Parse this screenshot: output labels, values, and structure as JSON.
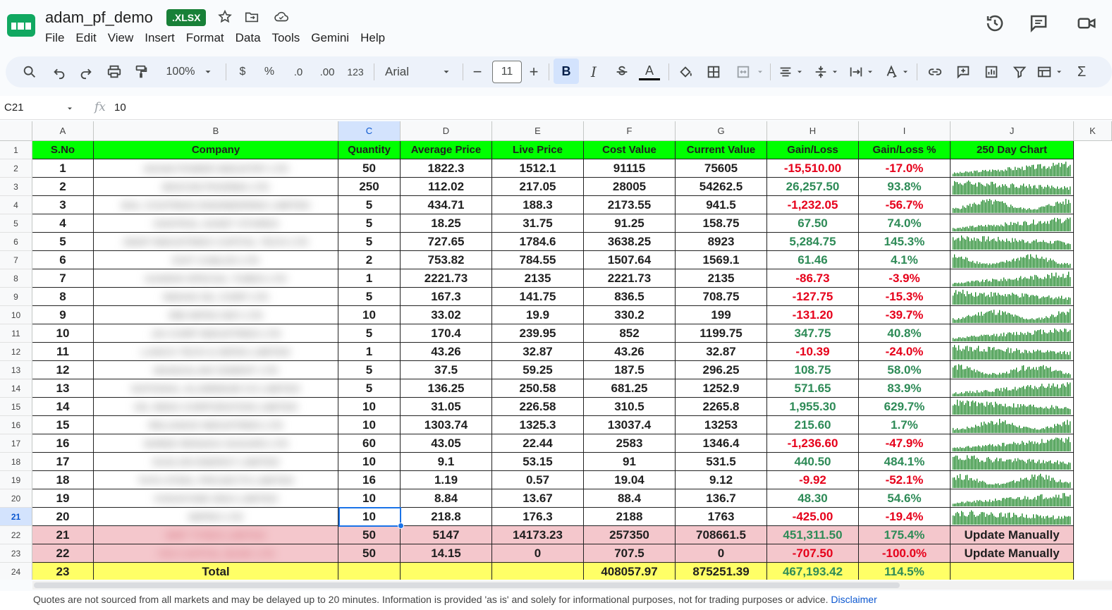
{
  "app": {
    "doc_title": "adam_pf_demo",
    "file_badge": ".XLSX",
    "menu": [
      "File",
      "Edit",
      "View",
      "Insert",
      "Format",
      "Data",
      "Tools",
      "Gemini",
      "Help"
    ]
  },
  "toolbar": {
    "zoom": "100%",
    "currency": "$",
    "percent": "%",
    "dec_decrease": ".0",
    "dec_increase": ".00",
    "number_format": "123",
    "font": "Arial",
    "font_size": "11",
    "minus": "−",
    "plus": "+",
    "bold": "B",
    "italic": "I",
    "text_color": "A",
    "sigma": "Σ"
  },
  "formula_bar": {
    "name_box": "C21",
    "fx": "fx",
    "value": "10"
  },
  "columns": [
    "A",
    "B",
    "C",
    "D",
    "E",
    "F",
    "G",
    "H",
    "I",
    "J",
    "K"
  ],
  "header_row": [
    "S.No",
    "Company",
    "Quantity",
    "Average Price",
    "Live Price",
    "Cost Value",
    "Current Value",
    "Gain/Loss",
    "Gain/Loss %",
    "250 Day Chart"
  ],
  "rows": [
    {
      "sno": "1",
      "company": "ADANI POWER INDUSTRY LTD",
      "qty": "50",
      "avg": "1822.3",
      "live": "1512.1",
      "cost": "91115",
      "cur": "75605",
      "gl": "-15,510.00",
      "glp": "-17.0%",
      "neg": true
    },
    {
      "sno": "2",
      "company": "BIOCON PHARMA LTD",
      "qty": "250",
      "avg": "112.02",
      "live": "217.05",
      "cost": "28005",
      "cur": "54262.5",
      "gl": "26,257.50",
      "glp": "93.8%",
      "neg": false
    },
    {
      "sno": "3",
      "company": "BAL COATINGS ENGINEERING LIMITED",
      "qty": "5",
      "avg": "434.71",
      "live": "188.3",
      "cost": "2173.55",
      "cur": "941.5",
      "gl": "-1,232.05",
      "glp": "-56.7%",
      "neg": true
    },
    {
      "sno": "4",
      "company": "CENTRAL ASSET STORES",
      "qty": "5",
      "avg": "18.25",
      "live": "31.75",
      "cost": "91.25",
      "cur": "158.75",
      "gl": "67.50",
      "glp": "74.0%",
      "neg": false
    },
    {
      "sno": "5",
      "company": "DEEP INDUSTRIES CAPITAL TECH LTD",
      "qty": "5",
      "avg": "727.65",
      "live": "1784.6",
      "cost": "3638.25",
      "cur": "8923",
      "gl": "5,284.75",
      "glp": "145.3%",
      "neg": false
    },
    {
      "sno": "6",
      "company": "EXIT CABLES LTD",
      "qty": "2",
      "avg": "753.82",
      "live": "784.55",
      "cost": "1507.64",
      "cur": "1569.1",
      "gl": "61.46",
      "glp": "4.1%",
      "neg": false
    },
    {
      "sno": "7",
      "company": "GANDHI SPECIAL TUBES LTD",
      "qty": "1",
      "avg": "2221.73",
      "live": "2135",
      "cost": "2221.73",
      "cur": "2135",
      "gl": "-86.73",
      "glp": "-3.9%",
      "neg": true
    },
    {
      "sno": "8",
      "company": "INDIAN OIL CORP LTD",
      "qty": "5",
      "avg": "167.3",
      "live": "141.75",
      "cost": "836.5",
      "cur": "708.75",
      "gl": "-127.75",
      "glp": "-15.3%",
      "neg": true
    },
    {
      "sno": "9",
      "company": "IRB INFRA DEV LTD",
      "qty": "10",
      "avg": "33.02",
      "live": "19.9",
      "cost": "330.2",
      "cur": "199",
      "gl": "-131.20",
      "glp": "-39.7%",
      "neg": true
    },
    {
      "sno": "10",
      "company": "JAI CORP INDUSTRIES LTD",
      "qty": "5",
      "avg": "170.4",
      "live": "239.95",
      "cost": "852",
      "cur": "1199.75",
      "gl": "347.75",
      "glp": "40.8%",
      "neg": false
    },
    {
      "sno": "11",
      "company": "LANCO TECH & INFRA LIMITED",
      "qty": "1",
      "avg": "43.26",
      "live": "32.87",
      "cost": "43.26",
      "cur": "32.87",
      "gl": "-10.39",
      "glp": "-24.0%",
      "neg": true
    },
    {
      "sno": "12",
      "company": "MANGALAM CEMENT LTD",
      "qty": "5",
      "avg": "37.5",
      "live": "59.25",
      "cost": "187.5",
      "cur": "296.25",
      "gl": "108.75",
      "glp": "58.0%",
      "neg": false
    },
    {
      "sno": "13",
      "company": "NATIONAL ALUMINIUM CO LIMITED",
      "qty": "5",
      "avg": "136.25",
      "live": "250.58",
      "cost": "681.25",
      "cur": "1252.9",
      "gl": "571.65",
      "glp": "83.9%",
      "neg": false
    },
    {
      "sno": "14",
      "company": "OIL INDIA CORPORATION LIMITED",
      "qty": "10",
      "avg": "31.05",
      "live": "226.58",
      "cost": "310.5",
      "cur": "2265.8",
      "gl": "1,955.30",
      "glp": "629.7%",
      "neg": false
    },
    {
      "sno": "15",
      "company": "RELIANCE INDUSTRIES LTD",
      "qty": "10",
      "avg": "1303.74",
      "live": "1325.3",
      "cost": "13037.4",
      "cur": "13253",
      "gl": "215.60",
      "glp": "1.7%",
      "neg": false
    },
    {
      "sno": "16",
      "company": "SHREE RENUKA SUGARS LTD",
      "qty": "60",
      "avg": "43.05",
      "live": "22.44",
      "cost": "2583",
      "cur": "1346.4",
      "gl": "-1,236.60",
      "glp": "-47.9%",
      "neg": true
    },
    {
      "sno": "17",
      "company": "SUZLON ENERGY LIMITED",
      "qty": "10",
      "avg": "9.1",
      "live": "53.15",
      "cost": "91",
      "cur": "531.5",
      "gl": "440.50",
      "glp": "484.1%",
      "neg": false
    },
    {
      "sno": "18",
      "company": "TATA STEEL PROJECTS LIMITED",
      "qty": "16",
      "avg": "1.19",
      "live": "0.57",
      "cost": "19.04",
      "cur": "9.12",
      "gl": "-9.92",
      "glp": "-52.1%",
      "neg": true
    },
    {
      "sno": "19",
      "company": "VODAFONE IDEA LIMITED",
      "qty": "10",
      "avg": "8.84",
      "live": "13.67",
      "cost": "88.4",
      "cur": "136.7",
      "gl": "48.30",
      "glp": "54.6%",
      "neg": false
    },
    {
      "sno": "20",
      "company": "WIPRO LTD",
      "qty": "10",
      "avg": "218.8",
      "live": "176.3",
      "cost": "2188",
      "cur": "1763",
      "gl": "-425.00",
      "glp": "-19.4%",
      "neg": true
    }
  ],
  "manual_rows": [
    {
      "sno": "21",
      "company": "MRF TYRES LIMITED",
      "qty": "50",
      "avg": "5147",
      "live": "14173.23",
      "cost": "257350",
      "cur": "708661.5",
      "gl": "451,311.50",
      "glp": "175.4%",
      "neg": false,
      "chart": "Update Manually"
    },
    {
      "sno": "22",
      "company": "YES CAPITAL BANK LTD",
      "qty": "50",
      "avg": "14.15",
      "live": "0",
      "cost": "707.5",
      "cur": "0",
      "gl": "-707.50",
      "glp": "-100.0%",
      "neg": true,
      "chart": "Update Manually"
    }
  ],
  "total_row": {
    "sno": "23",
    "label": "Total",
    "cost": "408057.97",
    "cur": "875251.39",
    "gl": "467,193.42",
    "glp": "114.5%"
  },
  "row_numbers": [
    "1",
    "2",
    "3",
    "4",
    "5",
    "6",
    "7",
    "8",
    "9",
    "10",
    "11",
    "12",
    "13",
    "14",
    "15",
    "16",
    "17",
    "18",
    "19",
    "20",
    "21",
    "22",
    "23",
    "24"
  ],
  "footer": {
    "text": "Quotes are not sourced from all markets and may be delayed up to 20 minutes. Information is provided 'as is' and solely for informational purposes, not for trading purposes or advice.",
    "link": "Disclaimer"
  },
  "colors": {
    "header_green": "#00ff00",
    "loss_red": "#e6001a",
    "gain_green": "#2e8b57",
    "manual_pink": "#f4c7cc",
    "total_yellow": "#ffff66",
    "spark_green": "#0a7d16",
    "accent_blue": "#1a73e8"
  }
}
